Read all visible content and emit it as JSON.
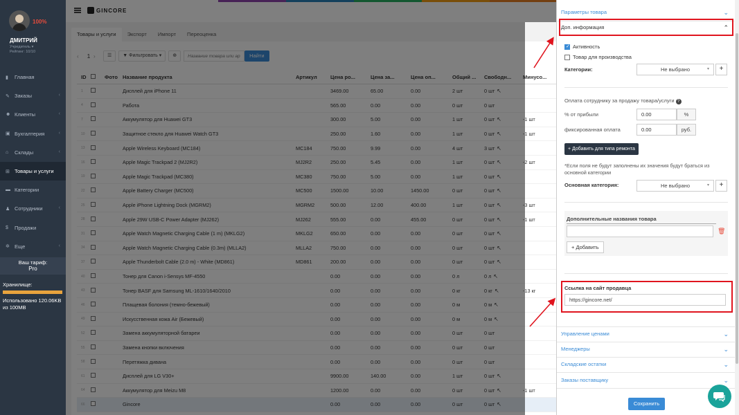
{
  "sidebar": {
    "percent": "100%",
    "user_name": "ДМИТРИЙ",
    "user_role": "Учредитель ▾",
    "user_rating": "Рейтинг: 10/10",
    "nav": [
      {
        "icon": "chart-icon",
        "glyph": "▮",
        "label": "Главная",
        "chev": ""
      },
      {
        "icon": "edit-icon",
        "glyph": "✎",
        "label": "Заказы",
        "chev": "‹"
      },
      {
        "icon": "users-icon",
        "glyph": "☻",
        "label": "Клиенты",
        "chev": "‹"
      },
      {
        "icon": "accounting-icon",
        "glyph": "▣",
        "label": "Бухгалтерия",
        "chev": "‹"
      },
      {
        "icon": "warehouse-icon",
        "glyph": "⌂",
        "label": "Склады",
        "chev": "‹"
      },
      {
        "icon": "cart-icon",
        "glyph": "⊞",
        "label": "Товары и услуги",
        "chev": ""
      },
      {
        "icon": "folder-icon",
        "glyph": "▬",
        "label": "Категории",
        "chev": ""
      },
      {
        "icon": "user-icon",
        "glyph": "♟",
        "label": "Сотрудники",
        "chev": "‹"
      },
      {
        "icon": "dollar-icon",
        "glyph": "$",
        "label": "Продажи",
        "chev": ""
      },
      {
        "icon": "more-icon",
        "glyph": "✲",
        "label": "Еще",
        "chev": "‹"
      }
    ],
    "active_index": 5,
    "tariff_label": "Ваш тариф:",
    "tariff_name": "Pro",
    "storage_label": "Хранилище:",
    "storage_used": "Использовано 120.06KB из 100MB",
    "storage_fraction": 1.0
  },
  "topbar": {
    "logo": "GINCORE"
  },
  "tabs": [
    "Товары и услуги",
    "Экспорт",
    "Импорт",
    "Переоценка"
  ],
  "toolbar": {
    "prev": "‹",
    "page": "1",
    "next": "›",
    "filter_label": "▼ Фильтровать ▾",
    "search_placeholder": "Название товара или ар",
    "find_label": "Найти"
  },
  "table": {
    "headers": [
      "ID",
      "Фото",
      "Название продукта",
      "Артикул",
      "Цена ро...",
      "Цена за...",
      "Цена оп...",
      "Общий ...",
      "Свободн...",
      "Минусо..."
    ],
    "rows": [
      {
        "id": "1",
        "name": "Дисплей для iPhone 11",
        "art": "",
        "p1": "3469.00",
        "p2": "65.00",
        "p3": "0.00",
        "tot": "2 шт",
        "free": "0 шт",
        "min": "",
        "wr": true
      },
      {
        "id": "4",
        "name": "Работа",
        "art": "",
        "p1": "565.00",
        "p2": "0.00",
        "p3": "0.00",
        "tot": "0 шт",
        "free": "0 шт",
        "min": "",
        "wr": false
      },
      {
        "id": "7",
        "name": "Аккумулятор для Huawei GT3",
        "art": "",
        "p1": "300.00",
        "p2": "5.00",
        "p3": "0.00",
        "tot": "1 шт",
        "free": "0 шт",
        "min": "-1 шт",
        "wr": true
      },
      {
        "id": "10",
        "name": "Защитное стекло для Huawei Watch GT3",
        "art": "",
        "p1": "250.00",
        "p2": "1.60",
        "p3": "0.00",
        "tot": "1 шт",
        "free": "0 шт",
        "min": "-1 шт",
        "wr": true
      },
      {
        "id": "13",
        "name": "Apple Wireless Keyboard (MC184)",
        "art": "MC184",
        "p1": "750.00",
        "p2": "9.99",
        "p3": "0.00",
        "tot": "4 шт",
        "free": "3 шт",
        "min": "",
        "wr": true
      },
      {
        "id": "16",
        "name": "Apple Magic Trackpad 2 (MJ2R2)",
        "art": "MJ2R2",
        "p1": "250.00",
        "p2": "5.45",
        "p3": "0.00",
        "tot": "1 шт",
        "free": "0 шт",
        "min": "-2 шт",
        "wr": true
      },
      {
        "id": "19",
        "name": "Apple Magic Trackpad (MC380)",
        "art": "MC380",
        "p1": "750.00",
        "p2": "5.00",
        "p3": "0.00",
        "tot": "1 шт",
        "free": "0 шт",
        "min": "",
        "wr": true
      },
      {
        "id": "22",
        "name": "Apple Battery Charger (MC500)",
        "art": "MC500",
        "p1": "1500.00",
        "p2": "10.00",
        "p3": "1450.00",
        "tot": "0 шт",
        "free": "0 шт",
        "min": "",
        "wr": true
      },
      {
        "id": "25",
        "name": "Apple iPhone Lightning Dock (MGRM2)",
        "art": "MGRM2",
        "p1": "500.00",
        "p2": "12.00",
        "p3": "400.00",
        "tot": "1 шт",
        "free": "0 шт",
        "min": "-3 шт",
        "wr": true
      },
      {
        "id": "28",
        "name": "Apple 29W USB-C Power Adapter (MJ262)",
        "art": "MJ262",
        "p1": "555.00",
        "p2": "0.00",
        "p3": "455.00",
        "tot": "0 шт",
        "free": "0 шт",
        "min": "-1 шт",
        "wr": true
      },
      {
        "id": "31",
        "name": "Apple Watch Magnetic Charging Cable (1 m) (MKLG2)",
        "art": "MKLG2",
        "p1": "650.00",
        "p2": "0.00",
        "p3": "0.00",
        "tot": "0 шт",
        "free": "0 шт",
        "min": "",
        "wr": true
      },
      {
        "id": "34",
        "name": "Apple Watch Magnetic Charging Cable (0.3m) (MLLA2)",
        "art": "MLLA2",
        "p1": "750.00",
        "p2": "0.00",
        "p3": "0.00",
        "tot": "0 шт",
        "free": "0 шт",
        "min": "",
        "wr": true
      },
      {
        "id": "37",
        "name": "Apple Thunderbolt Cable (2.0 m) - White (MD861)",
        "art": "MD861",
        "p1": "200.00",
        "p2": "0.00",
        "p3": "0.00",
        "tot": "0 шт",
        "free": "0 шт",
        "min": "",
        "wr": true
      },
      {
        "id": "40",
        "name": "Тонер для Canon i-Sensys MF-4550",
        "art": "",
        "p1": "0.00",
        "p2": "0.00",
        "p3": "0.00",
        "tot": "0 л",
        "free": "0 л",
        "min": "",
        "wr": true
      },
      {
        "id": "43",
        "name": "Тонер BASF для Samsung ML-1610/1640/2010",
        "art": "",
        "p1": "0.00",
        "p2": "0.00",
        "p3": "0.00",
        "tot": "0 кг",
        "free": "0 кг",
        "min": "-13 кг",
        "wr": true
      },
      {
        "id": "46",
        "name": "Плащевая болония (темно-бежевый)",
        "art": "",
        "p1": "0.00",
        "p2": "0.00",
        "p3": "0.00",
        "tot": "0 м",
        "free": "0 м",
        "min": "",
        "wr": true
      },
      {
        "id": "49",
        "name": "Искусственная кожа Air (Бежевый)",
        "art": "",
        "p1": "0.00",
        "p2": "0.00",
        "p3": "0.00",
        "tot": "0 м",
        "free": "0 м",
        "min": "",
        "wr": true
      },
      {
        "id": "52",
        "name": "Замена аккумуляторной батареи",
        "art": "",
        "p1": "0.00",
        "p2": "0.00",
        "p3": "0.00",
        "tot": "0 шт",
        "free": "0 шт",
        "min": "",
        "wr": false
      },
      {
        "id": "55",
        "name": "Замена кнопки включения",
        "art": "",
        "p1": "0.00",
        "p2": "0.00",
        "p3": "0.00",
        "tot": "0 шт",
        "free": "0 шт",
        "min": "",
        "wr": false
      },
      {
        "id": "58",
        "name": "Перетяжка дивана",
        "art": "",
        "p1": "0.00",
        "p2": "0.00",
        "p3": "0.00",
        "tot": "0 шт",
        "free": "0 шт",
        "min": "",
        "wr": false
      },
      {
        "id": "61",
        "name": "Дисплей для LG V30+",
        "art": "",
        "p1": "9900.00",
        "p2": "140.00",
        "p3": "0.00",
        "tot": "1 шт",
        "free": "0 шт",
        "min": "",
        "wr": true
      },
      {
        "id": "64",
        "name": "Аккумулятор для Meizu M8",
        "art": "",
        "p1": "1200.00",
        "p2": "0.00",
        "p3": "0.00",
        "tot": "0 шт",
        "free": "0 шт",
        "min": "-1 шт",
        "wr": true
      },
      {
        "id": "66",
        "name": "Gincore",
        "art": "",
        "p1": "0.00",
        "p2": "0.00",
        "p3": "0.00",
        "tot": "0 шт",
        "free": "0 шт",
        "min": "",
        "wr": true,
        "selected": true
      }
    ]
  },
  "drawer": {
    "sec_params": "Параметры товара",
    "sec_extra": "Доп. информация",
    "active_label": "Активность",
    "active_checked": true,
    "production_label": "Товар для производства",
    "production_checked": false,
    "categories_label": "Категории:",
    "not_selected": "Не выбрано",
    "payment_label": "Оплата сотруднику за продажу товара/услуги",
    "profit_label": "% от прибыли",
    "profit_value": "0.00",
    "profit_unit": "%",
    "fixed_label": "фиксированная оплата",
    "fixed_value": "0.00",
    "fixed_unit": "руб.",
    "add_repair_type": "+ Добавить для типа ремонта",
    "note": "*Если поля не будут заполнены их значения будут браться из основной категории",
    "main_category_label": "Основная категория:",
    "main_category_value": "Не выбрано",
    "extra_names_label": "Дополнительные названия товара",
    "add_label": "+ Добавить",
    "seller_link_label": "Ссылка на сайт продавца",
    "seller_link_value": "https://gincore.net/",
    "sec_prices": "Управление ценами",
    "sec_managers": "Менеджеры",
    "sec_stock": "Складские остатки",
    "sec_supplier": "Заказы поставщику",
    "save_label": "Сохранить"
  },
  "colors": {
    "accent": "#3a8bd6",
    "sidebar": "#2b3643",
    "highlight": "#e0141e",
    "chat": "#1aa39a"
  }
}
